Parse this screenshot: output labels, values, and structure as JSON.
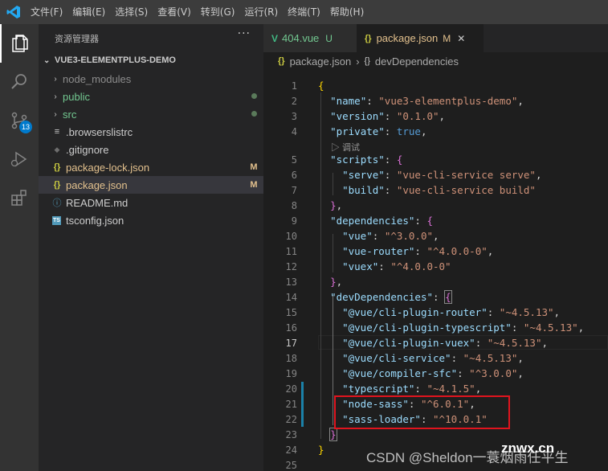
{
  "menu": [
    "文件(F)",
    "编辑(E)",
    "选择(S)",
    "查看(V)",
    "转到(G)",
    "运行(R)",
    "终端(T)",
    "帮助(H)"
  ],
  "activity": {
    "icons": [
      "files-icon",
      "search-icon",
      "source-control-icon",
      "run-debug-icon",
      "extensions-icon"
    ],
    "scm_badge": "13"
  },
  "sidebar": {
    "title": "资源管理器",
    "more": "···",
    "project": "VUE3-ELEMENTPLUS-DEMO",
    "items": [
      {
        "label": "node_modules",
        "type": "folder",
        "color": "#8c8c8c",
        "decoration": ""
      },
      {
        "label": "public",
        "type": "folder",
        "color": "#73c991",
        "decoration": "dot"
      },
      {
        "label": "src",
        "type": "folder",
        "color": "#73c991",
        "decoration": "dot"
      },
      {
        "label": ".browserslistrc",
        "type": "file",
        "icon": "≡",
        "color": "#cccccc",
        "decoration": ""
      },
      {
        "label": ".gitignore",
        "type": "file",
        "icon": "◆",
        "color": "#cccccc",
        "decoration": ""
      },
      {
        "label": "package-lock.json",
        "type": "file",
        "icon": "{}",
        "color": "#e2c08d",
        "decoration": "M"
      },
      {
        "label": "package.json",
        "type": "file",
        "icon": "{}",
        "color": "#e2c08d",
        "decoration": "M",
        "selected": true
      },
      {
        "label": "README.md",
        "type": "file",
        "icon": "ⓘ",
        "color": "#cccccc",
        "decoration": ""
      },
      {
        "label": "tsconfig.json",
        "type": "file",
        "icon": "TS",
        "color": "#cccccc",
        "decoration": ""
      }
    ]
  },
  "tabs": [
    {
      "label": "404.vue",
      "icon": "V",
      "status": "U",
      "active": false
    },
    {
      "label": "package.json",
      "icon": "{}",
      "status": "M",
      "active": true,
      "close": "✕"
    }
  ],
  "breadcrumb": [
    "package.json",
    "devDependencies"
  ],
  "codelens": "▷ 调试",
  "lines": [
    {
      "n": "1"
    },
    {
      "n": "2"
    },
    {
      "n": "3"
    },
    {
      "n": "4"
    },
    {
      "n": "5"
    },
    {
      "n": "6"
    },
    {
      "n": "7"
    },
    {
      "n": "8"
    },
    {
      "n": "9"
    },
    {
      "n": "10"
    },
    {
      "n": "11"
    },
    {
      "n": "12"
    },
    {
      "n": "13"
    },
    {
      "n": "14"
    },
    {
      "n": "15"
    },
    {
      "n": "16"
    },
    {
      "n": "17"
    },
    {
      "n": "18"
    },
    {
      "n": "19"
    },
    {
      "n": "20"
    },
    {
      "n": "21"
    },
    {
      "n": "22"
    },
    {
      "n": "23"
    },
    {
      "n": "24"
    },
    {
      "n": "25"
    }
  ],
  "code": {
    "l2k": "\"name\"",
    "l2v": "\"vue3-elementplus-demo\"",
    "l3k": "\"version\"",
    "l3v": "\"0.1.0\"",
    "l4k": "\"private\"",
    "l4v": "true",
    "l5k": "\"scripts\"",
    "l6k": "\"serve\"",
    "l6v": "\"vue-cli-service serve\"",
    "l7k": "\"build\"",
    "l7v": "\"vue-cli-service build\"",
    "l9k": "\"dependencies\"",
    "l10k": "\"vue\"",
    "l10v": "\"^3.0.0\"",
    "l11k": "\"vue-router\"",
    "l11v": "\"^4.0.0-0\"",
    "l12k": "\"vuex\"",
    "l12v": "\"^4.0.0-0\"",
    "l14k": "\"devDependencies\"",
    "l15k": "\"@vue/cli-plugin-router\"",
    "l15v": "\"~4.5.13\"",
    "l16k": "\"@vue/cli-plugin-typescript\"",
    "l16v": "\"~4.5.13\"",
    "l17k": "\"@vue/cli-plugin-vuex\"",
    "l17v": "\"~4.5.13\"",
    "l18k": "\"@vue/cli-service\"",
    "l18v": "\"~4.5.13\"",
    "l19k": "\"@vue/compiler-sfc\"",
    "l19v": "\"^3.0.0\"",
    "l20k": "\"typescript\"",
    "l20v": "\"~4.1.5\"",
    "l21k": "\"node-sass\"",
    "l21v": "\"^6.0.1\"",
    "l22k": "\"sass-loader\"",
    "l22v": "\"^10.0.1\""
  },
  "watermark": "CSDN @Sheldon一蓑烟雨任平生",
  "watermark2": "znwx.cn",
  "colors": {
    "highlight_box": "#e0141e",
    "accent": "#007acc"
  }
}
